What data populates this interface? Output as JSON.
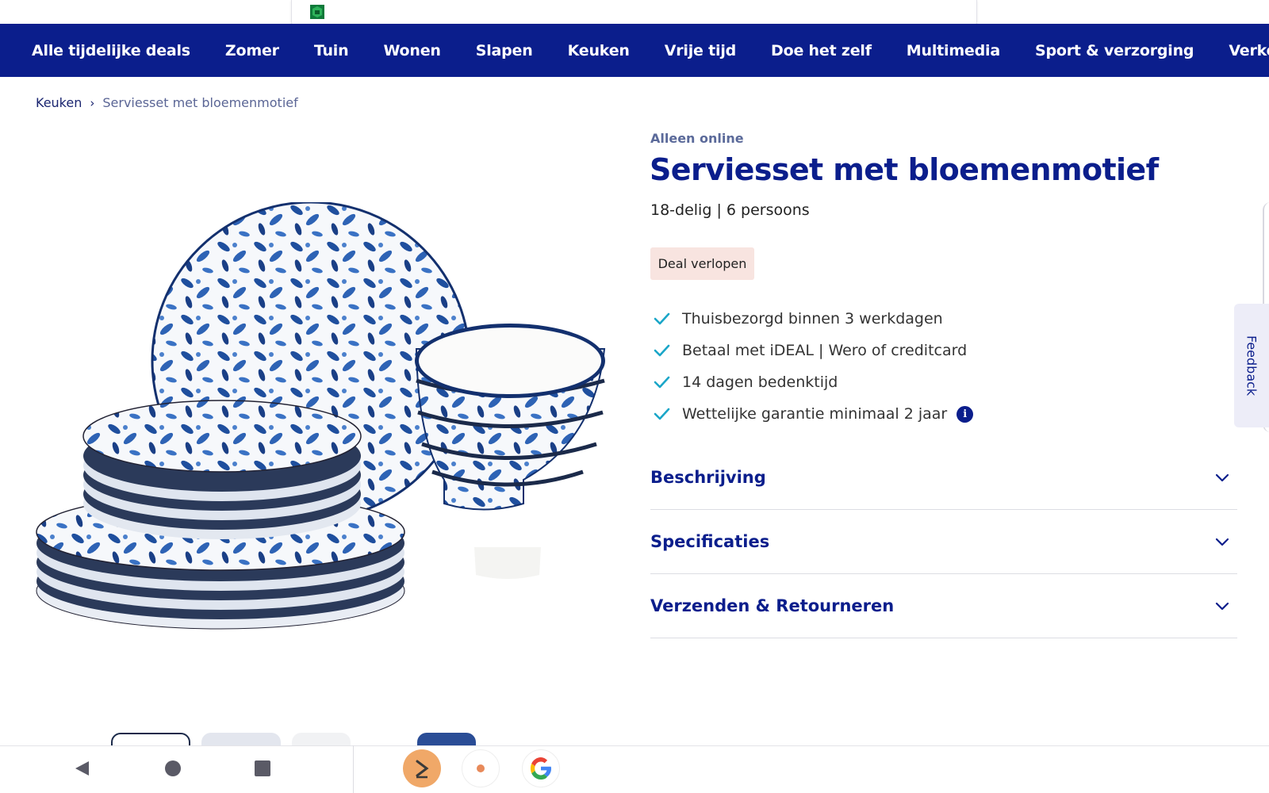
{
  "nav": {
    "items": [
      {
        "label": "Alle tijdelijke deals"
      },
      {
        "label": "Zomer"
      },
      {
        "label": "Tuin"
      },
      {
        "label": "Wonen"
      },
      {
        "label": "Slapen"
      },
      {
        "label": "Keuken"
      },
      {
        "label": "Vrije tijd"
      },
      {
        "label": "Doe het zelf"
      },
      {
        "label": "Multimedia"
      },
      {
        "label": "Sport & verzorging"
      },
      {
        "label": "Verkoeling"
      }
    ]
  },
  "breadcrumb": {
    "parent": "Keuken",
    "separator": "›",
    "current": "Serviesset met bloemenmotief"
  },
  "product": {
    "availability": "Alleen online",
    "title": "Serviesset met bloemenmotief",
    "subtitle": "18-delig | 6 persoons",
    "badge": "Deal verlopen",
    "usps": [
      {
        "text": "Thuisbezorgd binnen 3 werkdagen"
      },
      {
        "text": "Betaal met iDEAL | Wero of creditcard"
      },
      {
        "text": "14 dagen bedenktijd"
      },
      {
        "text": "Wettelijke garantie minimaal 2 jaar"
      }
    ],
    "info_glyph": "i"
  },
  "accordion": [
    {
      "title": "Beschrijving"
    },
    {
      "title": "Specificaties"
    },
    {
      "title": "Verzenden & Retourneren"
    }
  ],
  "feedback": {
    "label": "Feedback"
  },
  "colors": {
    "brand": "#0b1e8c",
    "check": "#1aa6c8",
    "badge_bg": "#f8e4e0",
    "pattern": "#1f4f9e"
  },
  "icons": {
    "check": "check-icon",
    "chevron": "chevron-down-icon",
    "info": "info-icon"
  }
}
